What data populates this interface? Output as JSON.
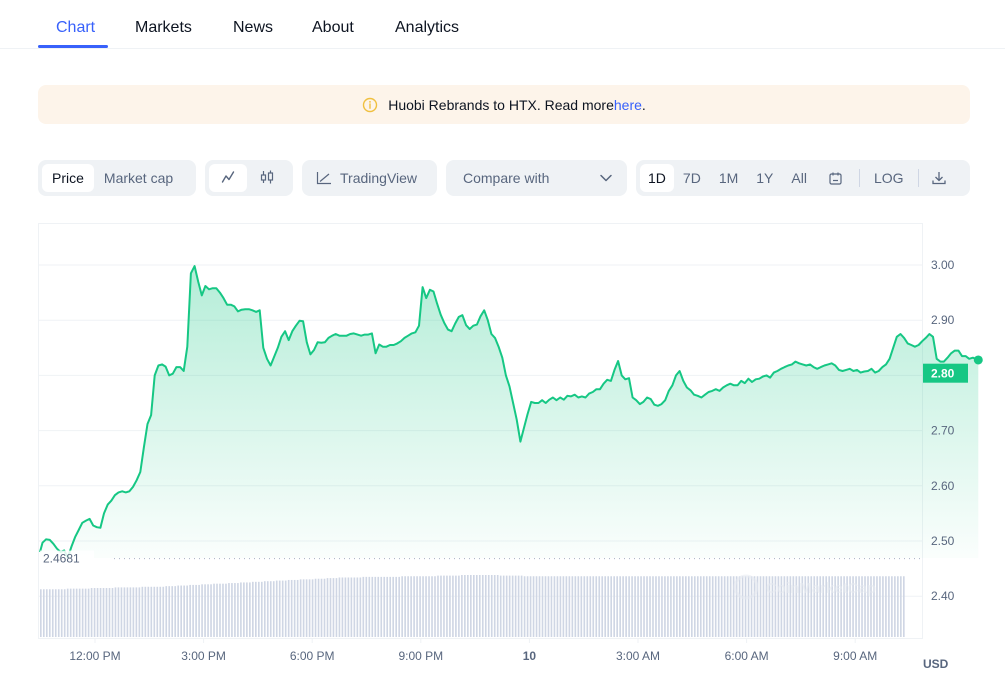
{
  "tabs": [
    {
      "label": "Chart",
      "active": true
    },
    {
      "label": "Markets",
      "active": false
    },
    {
      "label": "News",
      "active": false
    },
    {
      "label": "About",
      "active": false
    },
    {
      "label": "Analytics",
      "active": false
    }
  ],
  "banner": {
    "icon": "info-icon",
    "text": "Huobi Rebrands to HTX. Read more ",
    "link_text": "here",
    "suffix": "."
  },
  "toolbar": {
    "metric_toggle": [
      {
        "label": "Price",
        "active": true
      },
      {
        "label": "Market cap",
        "active": false
      }
    ],
    "chart_type_toggle": [
      {
        "icon": "line-chart-icon",
        "active": true
      },
      {
        "icon": "candlestick-icon",
        "active": false
      }
    ],
    "tradingview": {
      "icon": "tradingview-icon",
      "label": "TradingView"
    },
    "compare": {
      "label": "Compare with",
      "icon": "chevron-down-icon"
    },
    "ranges": [
      {
        "label": "1D",
        "active": true
      },
      {
        "label": "7D",
        "active": false
      },
      {
        "label": "1M",
        "active": false
      },
      {
        "label": "1Y",
        "active": false
      },
      {
        "label": "All",
        "active": false
      }
    ],
    "calendar_icon": "calendar-icon",
    "log_label": "LOG",
    "download_icon": "download-icon"
  },
  "colors": {
    "accent": "#3861fb",
    "up_green": "#16c784",
    "grid": "#eff2f5",
    "axis_text": "#58667e",
    "volume_bar": "#cfd6e4",
    "banner_bg": "#fdf4ea",
    "info_icon": "#f0b90b"
  },
  "chart_data": {
    "type": "area",
    "title": "",
    "xlabel": "",
    "ylabel": "USD",
    "currency_label": "USD",
    "y_ticks": [
      "3.00",
      "2.90",
      "2.80",
      "2.70",
      "2.60",
      "2.50",
      "2.40"
    ],
    "ylim": [
      2.36,
      3.06
    ],
    "x_ticks": [
      {
        "label": "12:00 PM",
        "hour": 0,
        "bold": false
      },
      {
        "label": "3:00 PM",
        "hour": 3,
        "bold": false
      },
      {
        "label": "6:00 PM",
        "hour": 6,
        "bold": false
      },
      {
        "label": "9:00 PM",
        "hour": 9,
        "bold": false
      },
      {
        "label": "10",
        "hour": 12,
        "bold": true
      },
      {
        "label": "3:00 AM",
        "hour": 15,
        "bold": false
      },
      {
        "label": "6:00 AM",
        "hour": 18,
        "bold": false
      },
      {
        "label": "9:00 AM",
        "hour": 21,
        "bold": false
      }
    ],
    "xlim_hours": [
      -1.52,
      24.4
    ],
    "current_price": {
      "label": "2.80",
      "value": 2.804
    },
    "open_price_line": {
      "label": "2.4681",
      "value": 2.4681
    },
    "watermark": "CoinMarketCap",
    "series": [
      {
        "name": "Price",
        "hours": [
          -1.52,
          -1.45,
          -1.35,
          -1.25,
          -1.15,
          -1.05,
          -0.95,
          -0.85,
          -0.75,
          -0.65,
          -0.55,
          -0.45,
          -0.35,
          -0.25,
          -0.15,
          -0.05,
          0.05,
          0.15,
          0.25,
          0.35,
          0.45,
          0.55,
          0.65,
          0.75,
          0.85,
          0.95,
          1.05,
          1.15,
          1.25,
          1.35,
          1.45,
          1.55,
          1.65,
          1.75,
          1.85,
          1.95,
          2.05,
          2.15,
          2.25,
          2.35,
          2.45,
          2.55,
          2.65,
          2.75,
          2.85,
          2.95,
          3.05,
          3.15,
          3.25,
          3.35,
          3.45,
          3.55,
          3.65,
          3.75,
          3.85,
          3.95,
          4.05,
          4.15,
          4.25,
          4.35,
          4.45,
          4.55,
          4.65,
          4.75,
          4.85,
          4.95,
          5.05,
          5.15,
          5.25,
          5.35,
          5.45,
          5.55,
          5.65,
          5.75,
          5.85,
          5.95,
          6.05,
          6.15,
          6.25,
          6.35,
          6.45,
          6.55,
          6.65,
          6.75,
          6.85,
          6.95,
          7.05,
          7.15,
          7.25,
          7.35,
          7.45,
          7.55,
          7.65,
          7.75,
          7.85,
          7.95,
          8.05,
          8.15,
          8.25,
          8.35,
          8.45,
          8.55,
          8.65,
          8.75,
          8.85,
          8.95,
          9.05,
          9.15,
          9.25,
          9.35,
          9.45,
          9.55,
          9.65,
          9.75,
          9.85,
          9.95,
          10.05,
          10.15,
          10.25,
          10.35,
          10.45,
          10.55,
          10.65,
          10.75,
          10.85,
          10.95,
          11.05,
          11.15,
          11.25,
          11.35,
          11.45,
          11.55,
          11.65,
          11.75,
          11.85,
          11.95,
          12.05,
          12.15,
          12.25,
          12.35,
          12.45,
          12.55,
          12.65,
          12.75,
          12.85,
          12.95,
          13.05,
          13.15,
          13.25,
          13.35,
          13.45,
          13.55,
          13.65,
          13.75,
          13.85,
          13.95,
          14.05,
          14.15,
          14.25,
          14.35,
          14.45,
          14.55,
          14.65,
          14.75,
          14.85,
          14.95,
          15.05,
          15.15,
          15.25,
          15.35,
          15.45,
          15.55,
          15.65,
          15.75,
          15.85,
          15.95,
          16.05,
          16.15,
          16.25,
          16.35,
          16.45,
          16.55,
          16.65,
          16.75,
          16.85,
          16.95,
          17.05,
          17.15,
          17.25,
          17.35,
          17.45,
          17.55,
          17.65,
          17.75,
          17.85,
          17.95,
          18.05,
          18.15,
          18.25,
          18.35,
          18.45,
          18.55,
          18.65,
          18.75,
          18.85,
          18.95,
          19.05,
          19.15,
          19.25,
          19.35,
          19.45,
          19.55,
          19.65,
          19.75,
          19.85,
          19.95,
          20.05,
          20.15,
          20.25,
          20.35,
          20.45,
          20.55,
          20.65,
          20.75,
          20.85,
          20.95,
          21.05,
          21.15,
          21.25,
          21.35,
          21.45,
          21.55,
          21.65,
          21.75,
          21.85,
          21.95,
          22.05,
          22.15,
          22.25,
          22.35,
          22.45,
          22.55,
          22.65,
          22.75,
          22.85,
          22.95,
          23.05,
          23.15,
          23.25,
          23.35,
          23.45,
          23.55,
          23.65,
          23.75,
          23.85,
          23.95,
          24.05,
          24.15,
          24.25,
          24.4
        ],
        "values": [
          2.48,
          2.497,
          2.503,
          2.502,
          2.495,
          2.486,
          2.48,
          2.483,
          2.47,
          2.49,
          2.507,
          2.52,
          2.533,
          2.537,
          2.54,
          2.528,
          2.525,
          2.524,
          2.55,
          2.566,
          2.573,
          2.583,
          2.588,
          2.59,
          2.588,
          2.59,
          2.598,
          2.61,
          2.625,
          2.67,
          2.712,
          2.728,
          2.8,
          2.818,
          2.82,
          2.816,
          2.8,
          2.803,
          2.815,
          2.815,
          2.808,
          2.852,
          2.985,
          2.998,
          2.97,
          2.945,
          2.962,
          2.956,
          2.958,
          2.958,
          2.95,
          2.94,
          2.928,
          2.928,
          2.925,
          2.916,
          2.919,
          2.92,
          2.92,
          2.918,
          2.915,
          2.918,
          2.85,
          2.83,
          2.818,
          2.834,
          2.85,
          2.87,
          2.88,
          2.864,
          2.88,
          2.89,
          2.899,
          2.898,
          2.86,
          2.838,
          2.846,
          2.86,
          2.859,
          2.86,
          2.868,
          2.872,
          2.875,
          2.872,
          2.872,
          2.872,
          2.875,
          2.876,
          2.874,
          2.872,
          2.874,
          2.874,
          2.876,
          2.84,
          2.856,
          2.852,
          2.852,
          2.855,
          2.855,
          2.858,
          2.862,
          2.868,
          2.872,
          2.876,
          2.878,
          2.89,
          2.96,
          2.94,
          2.955,
          2.952,
          2.93,
          2.91,
          2.895,
          2.883,
          2.88,
          2.894,
          2.906,
          2.909,
          2.891,
          2.884,
          2.89,
          2.892,
          2.907,
          2.918,
          2.9,
          2.875,
          2.868,
          2.852,
          2.832,
          2.8,
          2.78,
          2.75,
          2.72,
          2.68,
          2.705,
          2.73,
          2.752,
          2.75,
          2.75,
          2.755,
          2.75,
          2.756,
          2.76,
          2.755,
          2.76,
          2.756,
          2.763,
          2.762,
          2.765,
          2.76,
          2.762,
          2.76,
          2.767,
          2.77,
          2.775,
          2.775,
          2.785,
          2.792,
          2.79,
          2.81,
          2.826,
          2.8,
          2.793,
          2.795,
          2.76,
          2.755,
          2.748,
          2.752,
          2.76,
          2.757,
          2.747,
          2.745,
          2.748,
          2.755,
          2.772,
          2.782,
          2.8,
          2.808,
          2.79,
          2.778,
          2.773,
          2.765,
          2.763,
          2.76,
          2.765,
          2.77,
          2.772,
          2.775,
          2.772,
          2.778,
          2.782,
          2.785,
          2.782,
          2.782,
          2.79,
          2.786,
          2.794,
          2.788,
          2.793,
          2.794,
          2.798,
          2.8,
          2.796,
          2.805,
          2.808,
          2.812,
          2.815,
          2.818,
          2.82,
          2.825,
          2.822,
          2.82,
          2.818,
          2.82,
          2.815,
          2.812,
          2.815,
          2.818,
          2.82,
          2.822,
          2.818,
          2.81,
          2.808,
          2.81,
          2.812,
          2.808,
          2.81,
          2.805,
          2.807,
          2.808,
          2.812,
          2.805,
          2.808,
          2.815,
          2.82,
          2.83,
          2.85,
          2.87,
          2.875,
          2.868,
          2.858,
          2.855,
          2.852,
          2.855,
          2.862,
          2.868,
          2.875,
          2.87,
          2.83,
          2.825,
          2.825,
          2.832,
          2.84,
          2.845,
          2.845,
          2.835,
          2.835,
          2.83,
          2.832,
          2.828,
          2.83,
          2.828,
          2.826,
          2.825,
          2.825,
          2.822,
          2.812,
          2.808,
          2.808,
          2.806,
          2.804
        ]
      }
    ],
    "volume_relative": [
      0.77,
      0.77,
      0.78,
      0.78,
      0.79,
      0.79,
      0.8,
      0.8,
      0.81,
      0.81,
      0.82,
      0.83,
      0.84,
      0.85,
      0.86,
      0.87,
      0.88,
      0.89,
      0.9,
      0.91,
      0.92,
      0.93,
      0.94,
      0.95,
      0.96,
      0.96,
      0.97,
      0.97,
      0.97,
      0.98,
      0.98,
      0.98,
      0.99,
      0.99,
      1.0,
      1.0,
      1.0,
      0.99,
      0.99,
      0.98,
      0.98,
      0.98,
      0.98,
      0.98,
      0.98,
      0.98,
      0.98,
      0.98,
      0.98,
      0.98,
      0.98,
      0.98,
      0.98,
      0.98,
      0.98,
      0.98,
      0.98,
      0.98,
      0.98,
      0.98,
      0.98,
      0.98,
      0.98,
      0.98,
      0.98,
      0.98,
      0.98,
      0.98,
      0.98,
      0.98
    ]
  }
}
